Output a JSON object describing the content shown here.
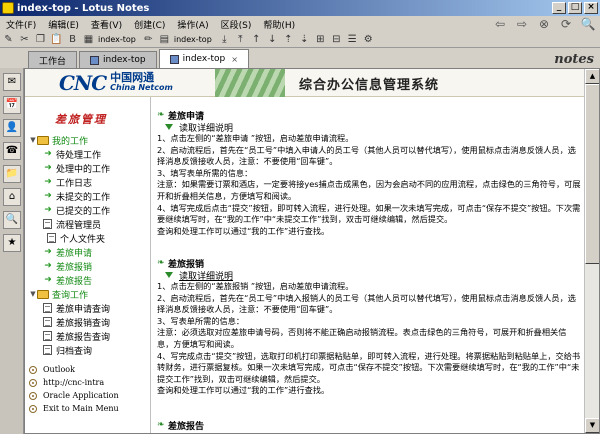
{
  "window": {
    "title": "index-top - Lotus Notes",
    "min_glyph": "_",
    "max_glyph": "□",
    "close_glyph": "×"
  },
  "menu": [
    "文件(F)",
    "编辑(E)",
    "查看(V)",
    "创建(C)",
    "操作(A)",
    "区段(S)",
    "帮助(H)"
  ],
  "nav_icons": {
    "back": "⇦",
    "forward": "⇨",
    "stop": "⊗",
    "refresh": "⟳",
    "search": "🔍"
  },
  "toolbar_labels": [
    "index-top",
    "index-top"
  ],
  "tabs": [
    {
      "label": "工作台"
    },
    {
      "label": "index-top"
    },
    {
      "label": "index-top",
      "close": "×"
    }
  ],
  "brand": {
    "notes": "notes"
  },
  "bookmarks": [
    "✉",
    "📅",
    "👤",
    "☎",
    "📁",
    "⌂",
    "🔍",
    "★"
  ],
  "banner": {
    "cnc": "CNC",
    "cn_name": "中国网通",
    "en_name": "China Netcom",
    "system_title": "综合办公信息管理系统"
  },
  "sidebar": {
    "heading": "差旅管理",
    "my_work": {
      "label": "我的工作",
      "items": [
        "待处理工作",
        "处理中的工作",
        "工作日志",
        "未提交的工作",
        "已提交的工作"
      ]
    },
    "docs": [
      "流程管理员",
      "个人文件夹"
    ],
    "green_items": [
      "差旅申请",
      "差旅报销",
      "差旅报告"
    ],
    "query": {
      "label": "查询工作",
      "items": [
        "差旅申请查询",
        "差旅报销查询",
        "差旅报告查询",
        "归档查询"
      ]
    },
    "links": [
      "Outlook",
      "http://cnc-intra",
      "Oracle Application",
      "Exit to Main Menu"
    ]
  },
  "sections": [
    {
      "title": "差旅申请",
      "sub": "读取详细说明",
      "text": "1、点击左侧的“差旅申请 ”按钮，启动差旅申请流程。\n2、启动流程后，首先在“员工号”中填入申请人的员工号（其他人员可以替代填写），使用鼠标点击消息反馈人员，选择消息反馈接收人员，注意：不要使用“回车键”。\n3、填写表单所需的信息：\n注意：如果需要订票和酒店，一定要将接yes捕点击成黑色，因为会启动不同的应用流程，点击绿色的三角符号，可展开和折叠相关信息，方便填写和阅读。\n4、填写完成后点击“提交”按钮，即可转入流程，进行处理。如果一次未填写完成，可点击“保存不提交”按钮。下次需要继续填写时，在“我的工作”中“未提交工作”找到，双击可继续编辑，然后提交。\n查询和处理工作可以通过“我的工作”进行查找。"
    },
    {
      "title": "差旅报销",
      "sub": "读取详细说明",
      "text": "1、点击左侧的“差旅报销 ”按钮，启动差旅申请流程。\n2、启动流程后，首先在“员工号”中填入报销人的员工号（其他人员可以替代填写），使用鼠标点击消息反馈人员，选择消息反馈接收人员，注意：不要使用“回车键”。\n3、写表单所需的信息：\n注意：必须选取对应差旅申请号码，否则将不能正确启动报销流程。表点击绿色的三角符号，可展开和折叠相关信息，方便填写和阅读。\n4、写完成点击“提交”按钮，选取打印机打印票据粘贴单，即可转入流程，进行处理。将票据粘贴到粘贴单上，交给书转财务，进行票据复核。如果一次未填写完成，可点击“保存不提交”按钮。下次需要继续填写时，在“我的工作”中“未提交工作”找到，双击可继续编辑，然后提交。\n查询和处理工作可以通过“我的工作”进行查找。"
    },
    {
      "title": "差旅报告"
    }
  ],
  "scroll": {
    "up": "▲",
    "down": "▼"
  }
}
